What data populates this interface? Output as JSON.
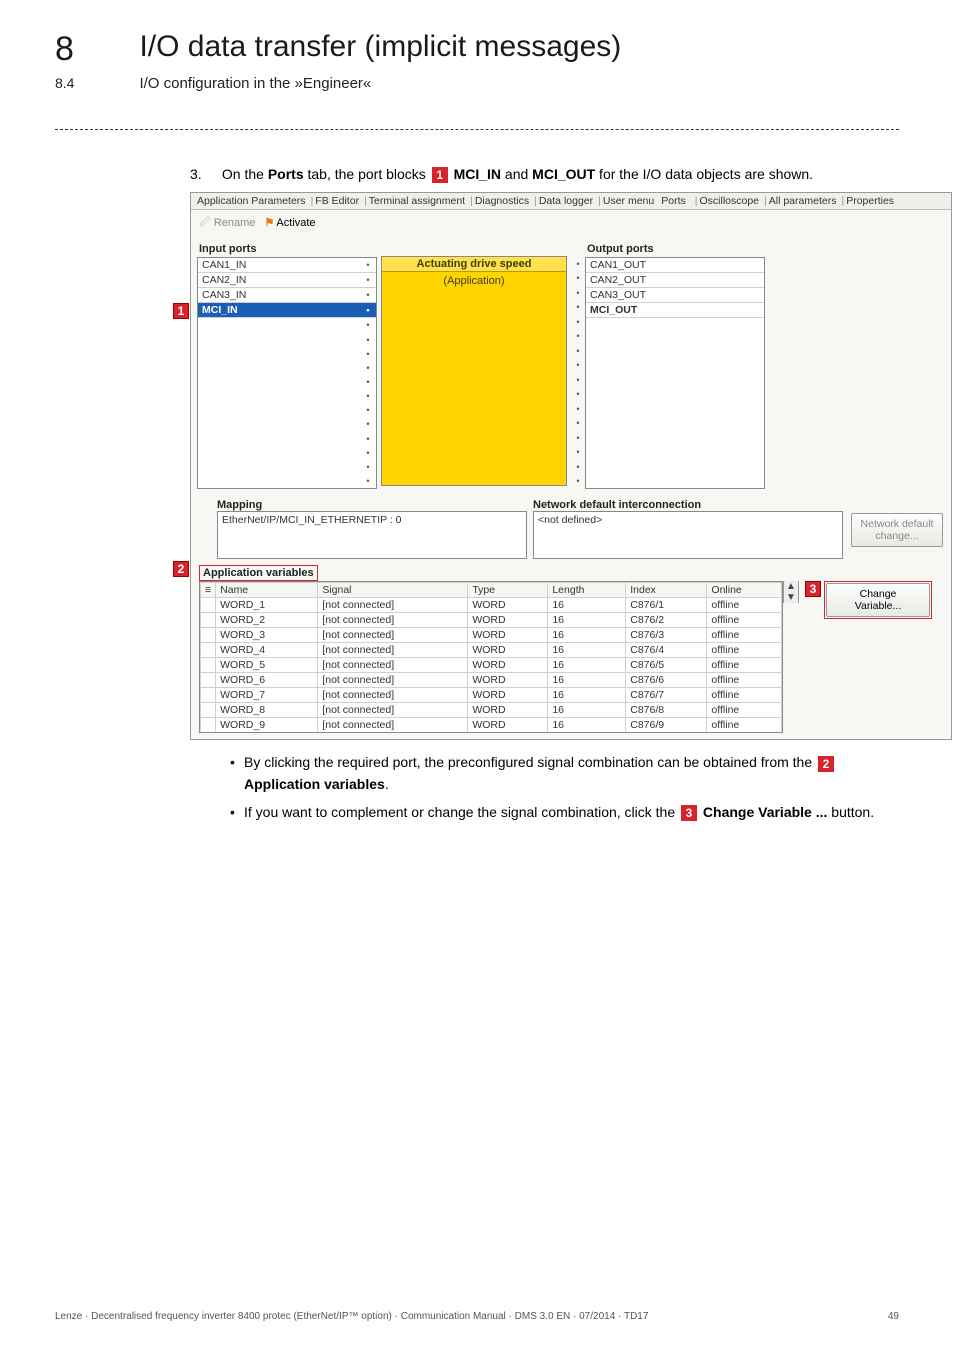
{
  "chapter": {
    "num": "8",
    "title": "I/O data transfer (implicit messages)"
  },
  "section": {
    "num": "8.4",
    "title": "I/O configuration in the »Engineer«"
  },
  "step": {
    "num": "3.",
    "text_a": "On the ",
    "ports_word": "Ports",
    "text_b": " tab, the port blocks ",
    "mci_in": " MCI_IN",
    "and_word": " and ",
    "mci_out": "MCI_OUT",
    "text_c": " for the I/O data objects are shown."
  },
  "markers": {
    "one": "1",
    "two": "2",
    "three": "3"
  },
  "tabs": [
    "Application Parameters",
    "FB Editor",
    "Terminal assignment",
    "Diagnostics",
    "Data logger",
    "User menu",
    "Ports",
    "Oscilloscope",
    "All parameters",
    "Properties"
  ],
  "toolbar": {
    "rename": "Rename",
    "activate": "Activate"
  },
  "ports": {
    "input_title": "Input ports",
    "output_title": "Output ports",
    "input": [
      "CAN1_IN",
      "CAN2_IN",
      "CAN3_IN",
      "MCI_IN"
    ],
    "output": [
      "CAN1_OUT",
      "CAN2_OUT",
      "CAN3_OUT",
      "MCI_OUT"
    ],
    "mid_head": "Actuating drive speed",
    "mid_app": "(Application)"
  },
  "mapping": {
    "left_title": "Mapping",
    "left_value": "EtherNet/IP/MCI_IN_ETHERNETIP : 0",
    "right_title": "Network default interconnection",
    "right_value": "<not defined>",
    "btn": "Network default change..."
  },
  "appvars": {
    "title": "Application variables",
    "cols": [
      "Name",
      "Signal",
      "Type",
      "Length",
      "Index",
      "Online"
    ],
    "rows": [
      {
        "name": "WORD_1",
        "signal": "[not connected]",
        "type": "WORD",
        "len": "16",
        "idx": "C876/1",
        "online": "offline"
      },
      {
        "name": "WORD_2",
        "signal": "[not connected]",
        "type": "WORD",
        "len": "16",
        "idx": "C876/2",
        "online": "offline"
      },
      {
        "name": "WORD_3",
        "signal": "[not connected]",
        "type": "WORD",
        "len": "16",
        "idx": "C876/3",
        "online": "offline"
      },
      {
        "name": "WORD_4",
        "signal": "[not connected]",
        "type": "WORD",
        "len": "16",
        "idx": "C876/4",
        "online": "offline"
      },
      {
        "name": "WORD_5",
        "signal": "[not connected]",
        "type": "WORD",
        "len": "16",
        "idx": "C876/5",
        "online": "offline"
      },
      {
        "name": "WORD_6",
        "signal": "[not connected]",
        "type": "WORD",
        "len": "16",
        "idx": "C876/6",
        "online": "offline"
      },
      {
        "name": "WORD_7",
        "signal": "[not connected]",
        "type": "WORD",
        "len": "16",
        "idx": "C876/7",
        "online": "offline"
      },
      {
        "name": "WORD_8",
        "signal": "[not connected]",
        "type": "WORD",
        "len": "16",
        "idx": "C876/8",
        "online": "offline"
      },
      {
        "name": "WORD_9",
        "signal": "[not connected]",
        "type": "WORD",
        "len": "16",
        "idx": "C876/9",
        "online": "offline"
      }
    ],
    "change_btn": "Change Variable..."
  },
  "bullets": {
    "b1_a": "By clicking the required port, the preconfigured signal combination can be obtained from the ",
    "b1_b": " Application variables",
    "b1_c": ".",
    "b2_a": "If you want to complement or change the signal combination, click the ",
    "b2_b": " Change Variable ...",
    "b2_c": " button."
  },
  "footer": {
    "left": "Lenze · Decentralised frequency inverter 8400 protec (EtherNet/IP™ option) · Communication Manual · DMS 3.0 EN · 07/2014 · TD17",
    "right": "49"
  }
}
